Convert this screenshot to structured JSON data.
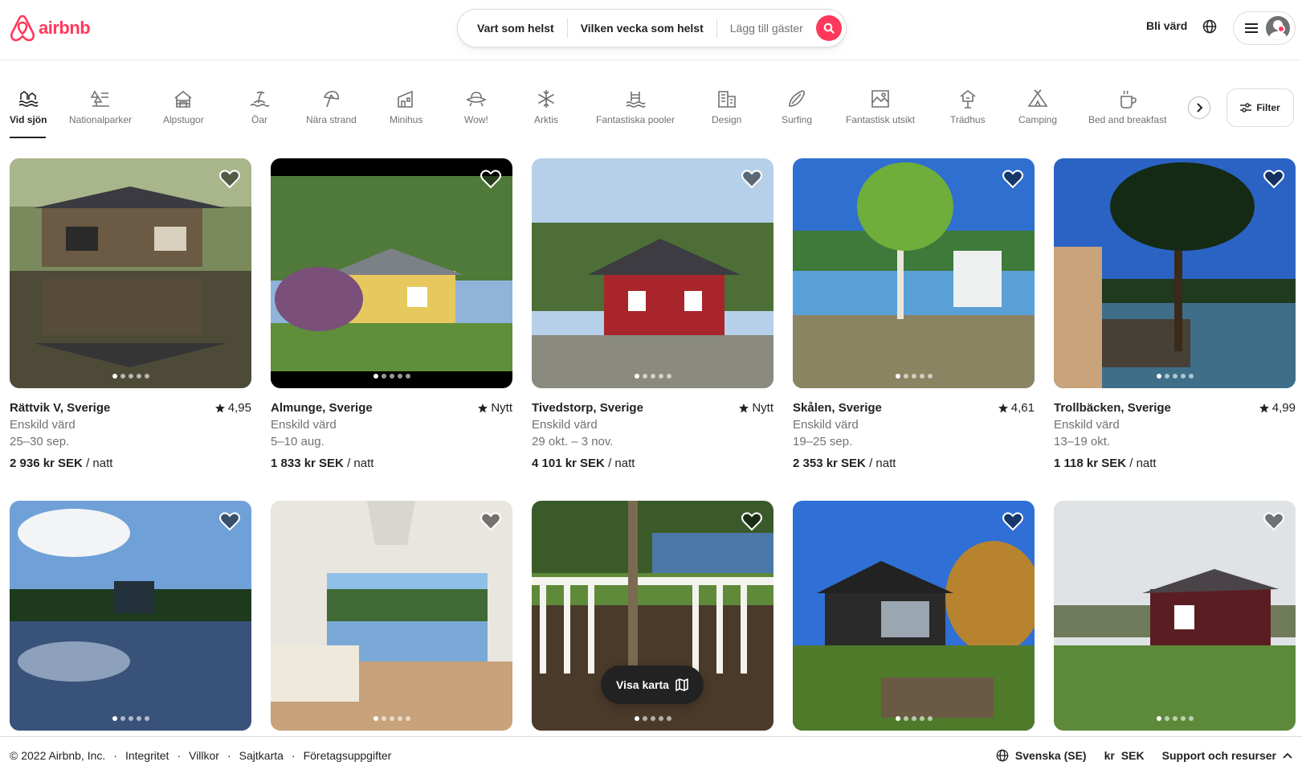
{
  "header": {
    "logo": "airbnb",
    "search": {
      "where": "Vart som helst",
      "when": "Vilken vecka som helst",
      "guests": "Lägg till gäster"
    },
    "host_label": "Bli värd"
  },
  "categories": [
    {
      "label": "Vid sjön",
      "icon": "lake-icon"
    },
    {
      "label": "Nationalparker",
      "icon": "national-park-icon"
    },
    {
      "label": "Alpstugor",
      "icon": "cabin-icon"
    },
    {
      "label": "Öar",
      "icon": "island-icon"
    },
    {
      "label": "Nära strand",
      "icon": "beach-icon"
    },
    {
      "label": "Minihus",
      "icon": "tiny-home-icon"
    },
    {
      "label": "Wow!",
      "icon": "ufo-icon"
    },
    {
      "label": "Arktis",
      "icon": "snowflake-icon"
    },
    {
      "label": "Fantastiska pooler",
      "icon": "pool-icon"
    },
    {
      "label": "Design",
      "icon": "design-icon"
    },
    {
      "label": "Surfing",
      "icon": "surfboard-icon"
    },
    {
      "label": "Fantastisk utsikt",
      "icon": "view-icon"
    },
    {
      "label": "Trädhus",
      "icon": "treehouse-icon"
    },
    {
      "label": "Camping",
      "icon": "tent-icon"
    },
    {
      "label": "Bed and breakfast",
      "icon": "coffee-icon"
    }
  ],
  "filter_label": "Filter",
  "listings": [
    {
      "location": "Rättvik V, Sverige",
      "rating": "4,95",
      "host": "Enskild värd",
      "dates": "25–30 sep.",
      "price": "2 936 kr SEK",
      "per": "/ natt"
    },
    {
      "location": "Almunge, Sverige",
      "rating": "Nytt",
      "host": "Enskild värd",
      "dates": "5–10 aug.",
      "price": "1 833 kr SEK",
      "per": "/ natt"
    },
    {
      "location": "Tivedstorp, Sverige",
      "rating": "Nytt",
      "host": "Enskild värd",
      "dates": "29 okt. – 3 nov.",
      "price": "4 101 kr SEK",
      "per": "/ natt"
    },
    {
      "location": "Skålen, Sverige",
      "rating": "4,61",
      "host": "Enskild värd",
      "dates": "19–25 sep.",
      "price": "2 353 kr SEK",
      "per": "/ natt"
    },
    {
      "location": "Trollbäcken, Sverige",
      "rating": "4,99",
      "host": "Enskild värd",
      "dates": "13–19 okt.",
      "price": "1 118 kr SEK",
      "per": "/ natt"
    }
  ],
  "map_button": "Visa karta",
  "footer": {
    "copyright": "© 2022 Airbnb, Inc.",
    "links": [
      "Integritet",
      "Villkor",
      "Sajtkarta",
      "Företagsuppgifter"
    ],
    "language": "Svenska (SE)",
    "currency_symbol": "kr",
    "currency": "SEK",
    "support": "Support och resurser"
  },
  "colors": {
    "brand": "#FF385C",
    "text": "#222222",
    "muted": "#717171"
  }
}
